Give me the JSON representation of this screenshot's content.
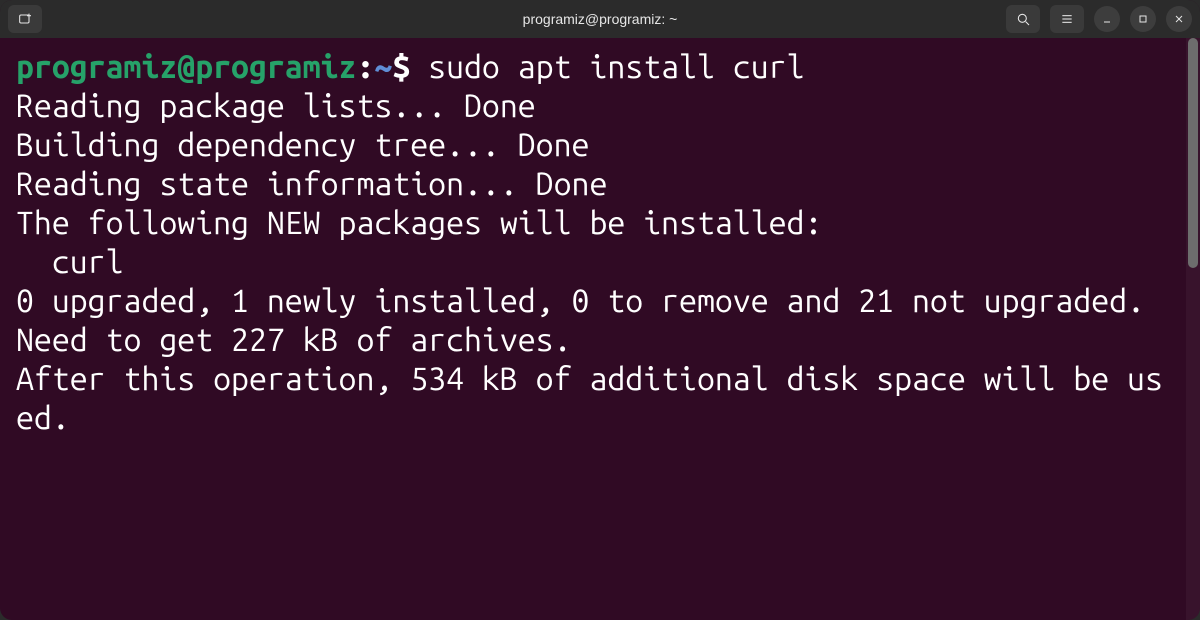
{
  "titlebar": {
    "title": "programiz@programiz: ~"
  },
  "prompt": {
    "user_host": "programiz@programiz",
    "separator": ":",
    "path": "~",
    "symbol": "$"
  },
  "command": "sudo apt install curl",
  "output": {
    "l1": "Reading package lists... Done",
    "l2": "Building dependency tree... Done",
    "l3": "Reading state information... Done",
    "l4": "The following NEW packages will be installed:",
    "l5": "  curl",
    "l6": "0 upgraded, 1 newly installed, 0 to remove and 21 not upgraded.",
    "l7": "Need to get 227 kB of archives.",
    "l8": "After this operation, 534 kB of additional disk space will be used."
  },
  "colors": {
    "bg": "#300a24",
    "prompt_user": "#26a269",
    "prompt_path": "#5f8ed6",
    "text": "#ffffff"
  }
}
